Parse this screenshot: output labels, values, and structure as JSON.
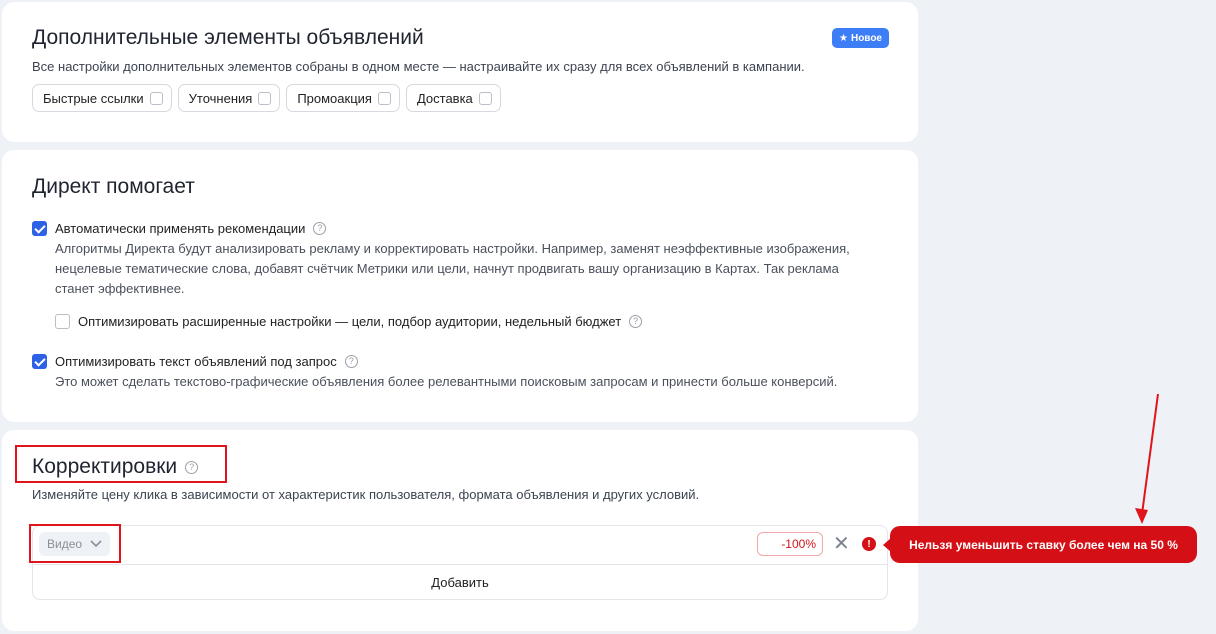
{
  "extras": {
    "title": "Дополнительные элементы объявлений",
    "badge": "Новое",
    "description": "Все настройки дополнительных элементов собраны в одном месте — настраивайте их сразу для всех объявлений в кампании.",
    "chips": [
      "Быстрые ссылки",
      "Уточнения",
      "Промоакция",
      "Доставка"
    ]
  },
  "direct": {
    "title": "Директ помогает",
    "auto_apply": {
      "label": "Автоматически применять рекомендации",
      "checked": true,
      "desc_lines": [
        "Алгоритмы Директа будут анализировать рекламу и корректировать настройки. Например, заменят неэффективные изображения,",
        "нецелевые тематические слова, добавят счётчик Метрики или цели, начнут продвигать вашу организацию в Картах. Так реклама",
        "станет эффективнее."
      ]
    },
    "optimize_advanced": {
      "label": "Оптимизировать расширенные настройки — цели, подбор аудитории, недельный бюджет",
      "checked": false
    },
    "optimize_text": {
      "label": "Оптимизировать текст объявлений под запрос",
      "checked": true,
      "desc": "Это может сделать текстово-графические объявления более релевантными поисковым запросам и принести больше конверсий."
    }
  },
  "adjustments": {
    "title": "Корректировки",
    "description": "Изменяйте цену клика в зависимости от характеристик пользователя, формата объявления и других условий.",
    "row": {
      "type": "Видео",
      "value": "-100%"
    },
    "add_label": "Добавить",
    "error": "Нельзя уменьшить ставку более чем на 50 %"
  },
  "colors": {
    "accent": "#2e62e6",
    "badge": "#3d7ef6",
    "error": "#d40f16"
  }
}
